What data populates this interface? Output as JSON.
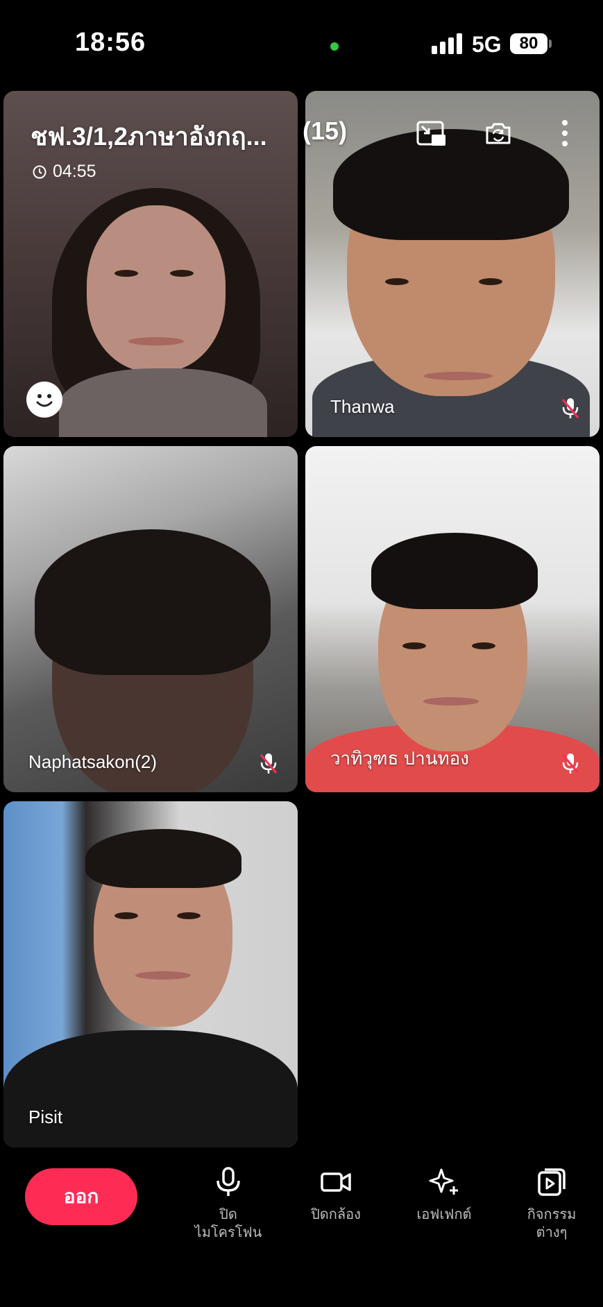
{
  "status_bar": {
    "time": "18:56",
    "network": "5G",
    "battery": "80"
  },
  "call": {
    "title": "ชฟ.3/1,2ภาษาอังกฤ...",
    "participant_count": "(15)",
    "duration": "04:55"
  },
  "participants": [
    {
      "name": "",
      "muted": false
    },
    {
      "name": "Thanwa",
      "muted": true
    },
    {
      "name": "Naphatsakon(2)",
      "muted": true
    },
    {
      "name": "วาทิวุฑธ  ปานทอง",
      "muted": true
    },
    {
      "name": "Pisit",
      "muted": false
    }
  ],
  "controls": {
    "leave_label": "ออก",
    "mic_label_1": "ปิด",
    "mic_label_2": "ไมโครโฟน",
    "camera_label": "ปิดกล้อง",
    "effects_label": "เอฟเฟกต์",
    "activities_label_1": "กิจกรรม",
    "activities_label_2": "ต่างๆ"
  },
  "icons": [
    "clock-icon",
    "minimize-pip-icon",
    "flip-camera-icon",
    "more-vertical-icon",
    "emoji-icon",
    "mic-off-icon",
    "mic-icon",
    "camera-icon",
    "sparkle-icon",
    "activities-icon"
  ]
}
